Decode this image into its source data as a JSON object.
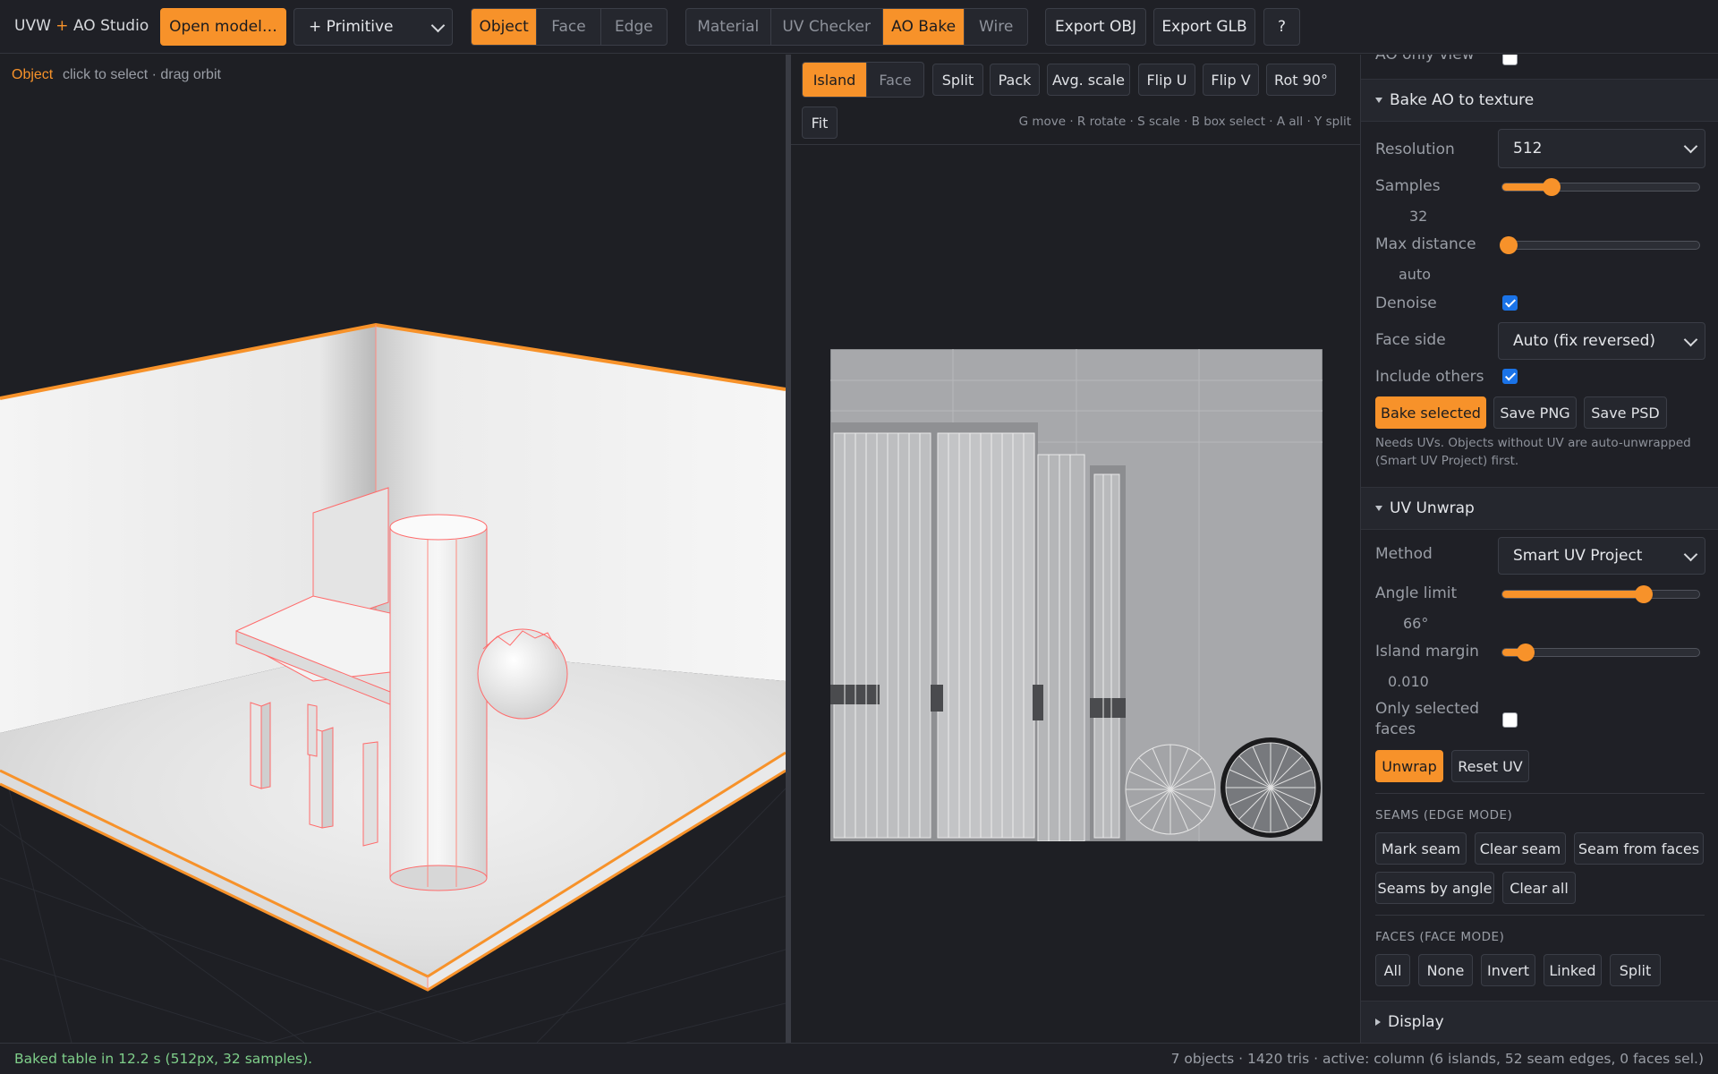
{
  "app": {
    "title_left": "UVW",
    "title_plus": "+",
    "title_right": "AO Studio"
  },
  "toolbar": {
    "open_model": "Open model…",
    "primitive": "+ Primitive",
    "modes": [
      "Object",
      "Face",
      "Edge"
    ],
    "active_mode": "Object",
    "views": [
      "Material",
      "UV Checker",
      "AO Bake",
      "Wire"
    ],
    "active_view": "AO Bake",
    "export_obj": "Export OBJ",
    "export_glb": "Export GLB",
    "help": "?"
  },
  "viewport": {
    "mode_label": "Object",
    "hint": "click to select · drag orbit"
  },
  "uv": {
    "select_modes": [
      "Island",
      "Face"
    ],
    "active_select": "Island",
    "tools": [
      "Split",
      "Pack",
      "Avg. scale",
      "Flip U",
      "Flip V",
      "Rot 90°"
    ],
    "fit": "Fit",
    "shortcuts": "G move · R rotate · S scale · B box select · A all · Y split"
  },
  "side": {
    "ao_only_view": "AO only view",
    "bake_section": "Bake AO to texture",
    "resolution_label": "Resolution",
    "resolution_value": "512",
    "samples_label": "Samples",
    "samples_value": "32",
    "samples_fraction": 0.25,
    "maxdist_label": "Max distance",
    "maxdist_value": "auto",
    "maxdist_fraction": 0.03,
    "denoise_label": "Denoise",
    "denoise_checked": true,
    "faceside_label": "Face side",
    "faceside_value": "Auto (fix reversed)",
    "include_label": "Include others",
    "include_checked": true,
    "bake_selected": "Bake selected",
    "save_png": "Save PNG",
    "save_psd": "Save PSD",
    "bake_note": "Needs UVs. Objects without UV are auto-unwrapped (Smart UV Project) first.",
    "unwrap_section": "UV Unwrap",
    "method_label": "Method",
    "method_value": "Smart UV Project",
    "angle_label": "Angle limit",
    "angle_value": "66°",
    "angle_fraction": 0.72,
    "margin_label": "Island margin",
    "margin_value": "0.010",
    "margin_fraction": 0.12,
    "only_sel_label": "Only selected faces",
    "only_sel_checked": false,
    "unwrap": "Unwrap",
    "reset_uv": "Reset UV",
    "seams_heading": "SEAMS (EDGE MODE)",
    "mark_seam": "Mark seam",
    "clear_seam": "Clear seam",
    "seam_from_faces": "Seam from faces",
    "seams_by_angle": "Seams by angle",
    "clear_all": "Clear all",
    "faces_heading": "FACES (FACE MODE)",
    "face_all": "All",
    "face_none": "None",
    "face_invert": "Invert",
    "face_linked": "Linked",
    "face_split": "Split",
    "display_section": "Display"
  },
  "status": {
    "left": "Baked table in 12.2 s (512px, 32 samples).",
    "right": "7 objects · 1420 tris · active: column (6 islands, 52 seam edges, 0 faces sel.)"
  },
  "colors": {
    "accent": "#f7922a",
    "status_ok": "#7fcf8a",
    "seam": "#ff5a5a"
  }
}
